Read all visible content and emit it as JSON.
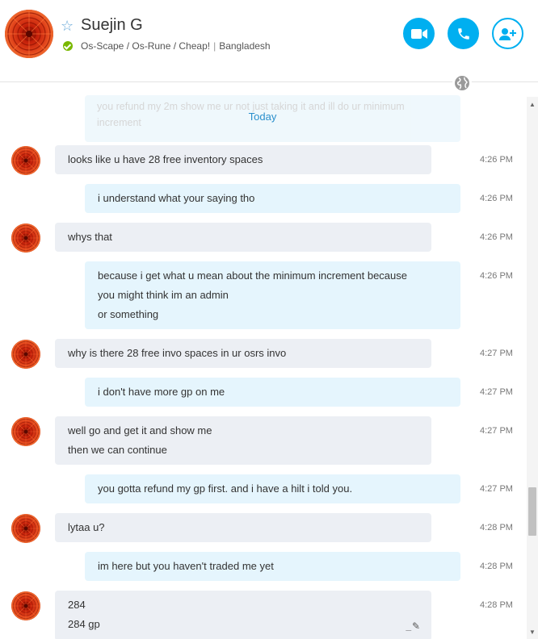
{
  "header": {
    "contact_name": "Suejin G",
    "mood_message": "Os-Scape / Os-Rune / Cheap!",
    "location": "Bangladesh",
    "status": "online",
    "favorite_icon": "star-outline-icon",
    "buttons": {
      "video_call": "video-call-icon",
      "voice_call": "phone-icon",
      "add_people": "add-contact-icon"
    },
    "accent_color": "#00aff0"
  },
  "conversation": {
    "faded_previous_message": "you refund my 2m show me ur not just taking it and ill do ur minimum increment",
    "date_separator": "Today",
    "messages": [
      {
        "direction": "in",
        "lines": [
          "looks like u have 28 free inventory spaces"
        ],
        "time": "4:26 PM"
      },
      {
        "direction": "out",
        "lines": [
          "i understand what your saying tho"
        ],
        "time": "4:26 PM"
      },
      {
        "direction": "in",
        "lines": [
          "whys that"
        ],
        "time": "4:26 PM"
      },
      {
        "direction": "out",
        "lines": [
          "because i get what u mean about the minimum increment because",
          "you might think im an admin",
          "or something"
        ],
        "time": "4:26 PM"
      },
      {
        "direction": "in",
        "lines": [
          "why is there 28 free invo spaces in ur osrs invo"
        ],
        "time": "4:27 PM"
      },
      {
        "direction": "out",
        "lines": [
          "i don't have more gp on me"
        ],
        "time": "4:27 PM"
      },
      {
        "direction": "in",
        "lines": [
          "well go and get it and show me",
          "then we can continue"
        ],
        "time": "4:27 PM"
      },
      {
        "direction": "out",
        "lines": [
          "you gotta refund my gp first. and i have a hilt i told you."
        ],
        "time": "4:27 PM"
      },
      {
        "direction": "in",
        "lines": [
          "lytaa u?"
        ],
        "time": "4:28 PM"
      },
      {
        "direction": "out",
        "lines": [
          "im here but you haven't traded me yet"
        ],
        "time": "4:28 PM"
      },
      {
        "direction": "in",
        "lines": [
          "284",
          "284 gp"
        ],
        "time": "4:28 PM",
        "edited": true
      }
    ]
  }
}
